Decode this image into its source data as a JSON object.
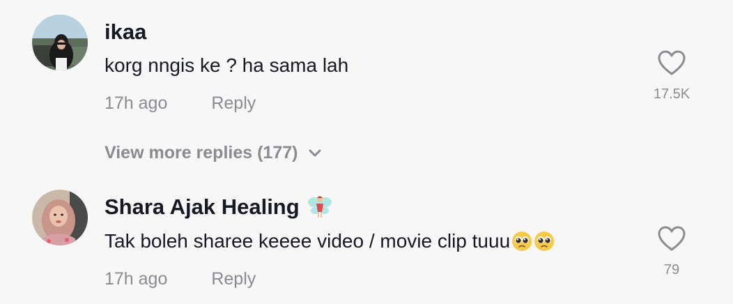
{
  "comments": [
    {
      "username": "ikaa",
      "text": "korg nngis ke ? ha sama lah",
      "time": "17h ago",
      "reply_label": "Reply",
      "like_count": "17.5K"
    },
    {
      "username": "Shara Ajak Healing",
      "text": "Tak boleh sharee keeee video / movie clip tuuu",
      "time": "17h ago",
      "reply_label": "Reply",
      "like_count": "79"
    }
  ],
  "view_more": {
    "label": "View more replies (177)"
  },
  "icons": {
    "heart": "heart-outline-icon",
    "chevron": "chevron-down-icon",
    "fairy": "fairy-emoji-icon",
    "pleading": "pleading-face-emoji-icon"
  },
  "colors": {
    "background": "#f7f7f7",
    "primary_text": "#161823",
    "secondary_text": "#8a8b91"
  }
}
